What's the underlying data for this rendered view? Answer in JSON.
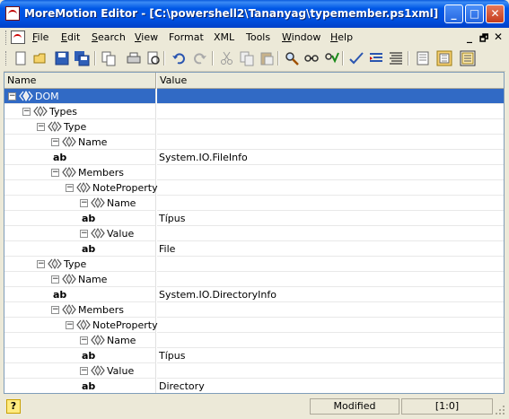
{
  "window": {
    "title": "MoreMotion Editor - [C:\\powershell2\\Tananyag\\typemember.ps1xml]",
    "minimize_glyph": "_",
    "maximize_glyph": "□",
    "close_glyph": "✕"
  },
  "menu": {
    "items": [
      {
        "label": "File",
        "ul": "F",
        "rest": "ile"
      },
      {
        "label": "Edit",
        "ul": "E",
        "rest": "dit"
      },
      {
        "label": "Search",
        "ul": "S",
        "rest": "earch"
      },
      {
        "label": "View",
        "ul": "V",
        "rest": "iew"
      },
      {
        "label": "Format",
        "ul": "",
        "rest": "Format"
      },
      {
        "label": "XML",
        "ul": "",
        "rest": "XML"
      },
      {
        "label": "Tools",
        "ul": "",
        "rest": "Tools"
      },
      {
        "label": "Window",
        "ul": "W",
        "rest": "indow"
      },
      {
        "label": "Help",
        "ul": "H",
        "rest": "elp"
      }
    ],
    "mdi_min": "_",
    "mdi_restore": "🗗",
    "mdi_close": "✕"
  },
  "toolbar": {
    "icons": [
      "new-icon",
      "open-icon",
      "save-icon",
      "save-all-icon",
      "copy-doc-icon",
      "print-icon",
      "print-preview-icon",
      "undo-icon",
      "redo-icon",
      "cut-icon",
      "copy-icon",
      "paste-icon",
      "find-icon",
      "find-replace-icon",
      "validate-icon",
      "check-icon",
      "indent-icon",
      "format-icon",
      "view-text-icon",
      "view-tree-icon",
      "view-split-icon"
    ]
  },
  "grid": {
    "columns": [
      "Name",
      "Value"
    ],
    "rows": [
      {
        "depth": 0,
        "kind": "element",
        "name": "DOM",
        "value": "",
        "selected": true
      },
      {
        "depth": 1,
        "kind": "element",
        "name": "Types",
        "value": ""
      },
      {
        "depth": 2,
        "kind": "element",
        "name": "Type",
        "value": ""
      },
      {
        "depth": 3,
        "kind": "element",
        "name": "Name",
        "value": ""
      },
      {
        "depth": 4,
        "kind": "text",
        "name": "ab",
        "value": "System.IO.FileInfo"
      },
      {
        "depth": 3,
        "kind": "element",
        "name": "Members",
        "value": ""
      },
      {
        "depth": 4,
        "kind": "element",
        "name": "NoteProperty",
        "value": ""
      },
      {
        "depth": 5,
        "kind": "element",
        "name": "Name",
        "value": ""
      },
      {
        "depth": 6,
        "kind": "text",
        "name": "ab",
        "value": "Típus"
      },
      {
        "depth": 5,
        "kind": "element",
        "name": "Value",
        "value": ""
      },
      {
        "depth": 6,
        "kind": "text",
        "name": "ab",
        "value": "File"
      },
      {
        "depth": 2,
        "kind": "element",
        "name": "Type",
        "value": ""
      },
      {
        "depth": 3,
        "kind": "element",
        "name": "Name",
        "value": ""
      },
      {
        "depth": 4,
        "kind": "text",
        "name": "ab",
        "value": "System.IO.DirectoryInfo"
      },
      {
        "depth": 3,
        "kind": "element",
        "name": "Members",
        "value": ""
      },
      {
        "depth": 4,
        "kind": "element",
        "name": "NoteProperty",
        "value": ""
      },
      {
        "depth": 5,
        "kind": "element",
        "name": "Name",
        "value": ""
      },
      {
        "depth": 6,
        "kind": "text",
        "name": "ab",
        "value": "Típus"
      },
      {
        "depth": 5,
        "kind": "element",
        "name": "Value",
        "value": ""
      },
      {
        "depth": 6,
        "kind": "text",
        "name": "ab",
        "value": "Directory"
      }
    ]
  },
  "status": {
    "help_glyph": "?",
    "state": "Modified",
    "position": "[1:0]"
  },
  "colors": {
    "title_bar": "#0058e6",
    "selection": "#316ac5",
    "window_face": "#ece9d8"
  }
}
